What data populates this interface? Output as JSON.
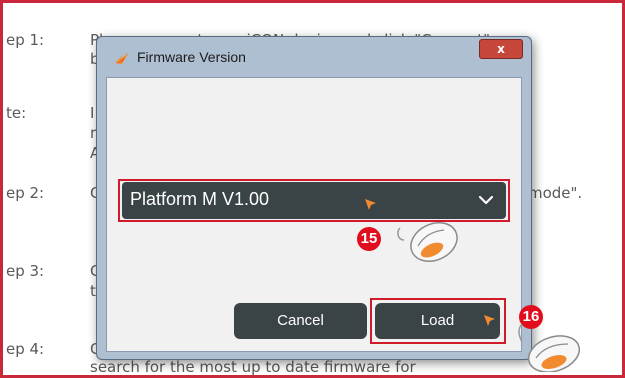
{
  "background": {
    "rows": [
      {
        "label": "ep 1:",
        "text_top": "Please connect your iCON device and click \"Connect\"",
        "text_bottom": "b"
      },
      {
        "label": "te:",
        "line1": "I",
        "line2": "r",
        "line3": "A"
      },
      {
        "label": "ep 2:",
        "text_left": "C",
        "text_right": "e mode\"."
      },
      {
        "label": "ep 3:",
        "text_left": "C",
        "text_left2": "t"
      },
      {
        "label": "ep 4:",
        "text_left": "C",
        "text_bottom": "search for the most up to date firmware for"
      }
    ]
  },
  "dialog": {
    "title": "Firmware Version",
    "close_label": "x",
    "select_value": "Platform M V1.00",
    "cancel_label": "Cancel",
    "load_label": "Load"
  },
  "annotations": {
    "step_select": "15",
    "step_load": "16"
  },
  "colors": {
    "highlight": "#d11a2a",
    "dark_control": "#3a4346",
    "cursor": "#f28b30"
  }
}
